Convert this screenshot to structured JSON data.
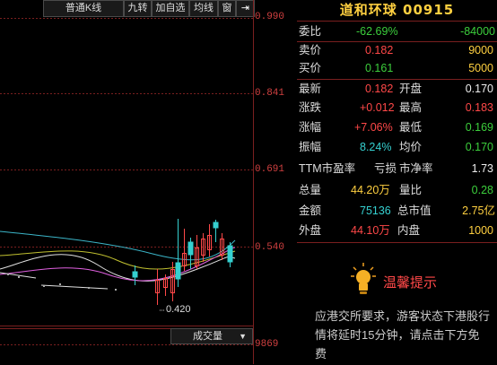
{
  "toolbar": {
    "items": [
      "普通K线",
      "九转",
      "加自选",
      "均线",
      "窗"
    ],
    "back_icon": "back-icon"
  },
  "price_axis": [
    "0.990",
    "0.841",
    "0.691",
    "0.540"
  ],
  "volume_axis": "9869",
  "low_marker": "0.420",
  "volume_select": "成交量",
  "stock": {
    "name": "道和环球",
    "code": "00915"
  },
  "quote": {
    "weibi": {
      "label": "委比",
      "pct": "-62.69%",
      "value": "-84000"
    },
    "sell": {
      "label": "卖价",
      "price": "0.182",
      "qty": "9000"
    },
    "buy": {
      "label": "买价",
      "price": "0.161",
      "qty": "5000"
    },
    "latest": {
      "label": "最新",
      "value": "0.182"
    },
    "open": {
      "label": "开盘",
      "value": "0.170"
    },
    "change": {
      "label": "涨跌",
      "value": "+0.012"
    },
    "high": {
      "label": "最高",
      "value": "0.183"
    },
    "change_pct": {
      "label": "涨幅",
      "value": "+7.06%"
    },
    "low": {
      "label": "最低",
      "value": "0.169"
    },
    "amplitude": {
      "label": "振幅",
      "value": "8.24%"
    },
    "avg": {
      "label": "均价",
      "value": "0.170"
    },
    "pe_label": "TTM市盈率",
    "pe_value": "亏损",
    "pb": {
      "label": "市净率",
      "value": "1.73"
    },
    "volume": {
      "label": "总量",
      "value": "44.20万"
    },
    "vol_ratio": {
      "label": "量比",
      "value": "0.28"
    },
    "amount": {
      "label": "金额",
      "value": "75136"
    },
    "mkt_cap": {
      "label": "总市值",
      "value": "2.75亿"
    },
    "outer": {
      "label": "外盘",
      "value": "44.10万"
    },
    "inner": {
      "label": "内盘",
      "value": "1000"
    }
  },
  "notice": {
    "title": "温馨提示",
    "text": "应港交所要求，游客状态下港股行情将延时15分钟，请点击下方免费"
  },
  "colors": {
    "up": "#ff4848",
    "down": "#3ccf3c",
    "accent": "#ffd040"
  }
}
